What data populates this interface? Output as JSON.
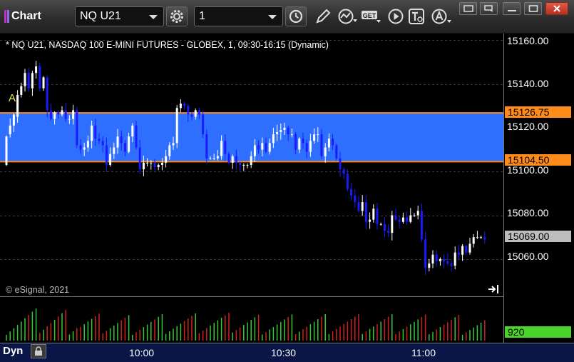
{
  "window": {
    "title": "Chart"
  },
  "toolbar": {
    "symbol": "NQ U21",
    "interval": "1",
    "icons": [
      "settings-gear-icon",
      "clock-icon",
      "pencil-icon",
      "study-icon",
      "get-icon",
      "play-icon",
      "text-tool-icon",
      "alert-icon"
    ],
    "get_label": "GET"
  },
  "chart": {
    "header": "* NQ U21, NASDAQ 100 E-MINI FUTURES - GLOBEX, 1, 09:30-16:15 (Dynamic)",
    "copyright": "© eSignal, 2021",
    "annotation": "A",
    "price_ticks": [
      "15160.00",
      "15140.00",
      "15120.00",
      "15100.00",
      "15080.00",
      "15060.00"
    ],
    "time_ticks": [
      "10:00",
      "10:30",
      "11:00"
    ],
    "zone_top": "15126.75",
    "zone_bottom": "15104.50",
    "last_price": "15069.00",
    "volume_last": "920",
    "mode": "Dyn"
  },
  "colors": {
    "zone": "#2f6fff",
    "zone_border": "#ff8c1a",
    "down": "#1a1aff",
    "up": "#ffffff",
    "vol_up": "#37c837",
    "vol_down": "#d02020"
  },
  "chart_data": {
    "type": "candlestick",
    "ylim": [
      15043,
      15163
    ],
    "zone": [
      15104.5,
      15126.75
    ],
    "opens": [
      15103,
      15117,
      15121,
      15125,
      15135,
      15139,
      15145,
      15138,
      15145,
      15148,
      15138,
      15143,
      15128,
      15124,
      15127,
      15126,
      15128,
      15124,
      15124,
      15128,
      15112,
      15110,
      15111,
      15114,
      15121,
      15115,
      15114,
      15112,
      15103,
      15108,
      15111,
      15116,
      15113,
      15109,
      15116,
      15121,
      15111,
      15101,
      15104,
      15104,
      15104,
      15102,
      15103,
      15104,
      15107,
      15112,
      15113,
      15129,
      15131,
      15130,
      15126,
      15125,
      15128,
      15126,
      15117,
      15106,
      15106,
      15106,
      15107,
      15114,
      15108,
      15104,
      15107,
      15104,
      15103,
      15103,
      15103,
      15107,
      15112,
      15110,
      15113,
      15109,
      15113,
      15117,
      15118,
      15119,
      15120,
      15117,
      15117,
      15110,
      15115,
      15113,
      15109,
      15114,
      15117,
      15117,
      15107,
      15111,
      15115,
      15112,
      15106,
      15101,
      15099,
      15092,
      15089,
      15086,
      15082,
      15086,
      15077,
      15078,
      15083,
      15076,
      15076,
      15073,
      15072,
      15080,
      15078,
      15077,
      15079,
      15077,
      15080,
      15080,
      15082,
      15069,
      15056,
      15058,
      15062,
      15059,
      15060,
      15059,
      15058,
      15057,
      15063,
      15062,
      15066,
      15063,
      15067,
      15070,
      15070,
      15070
    ],
    "closes": [
      15116,
      15121,
      15126,
      15135,
      15139,
      15145,
      15138,
      15145,
      15148,
      15138,
      15143,
      15128,
      15124,
      15127,
      15126,
      15128,
      15124,
      15124,
      15128,
      15112,
      15110,
      15111,
      15114,
      15121,
      15115,
      15114,
      15112,
      15103,
      15108,
      15111,
      15116,
      15113,
      15109,
      15116,
      15121,
      15111,
      15101,
      15104,
      15104,
      15104,
      15102,
      15103,
      15104,
      15107,
      15112,
      15113,
      15129,
      15131,
      15130,
      15126,
      15125,
      15128,
      15126,
      15117,
      15106,
      15106,
      15106,
      15107,
      15114,
      15108,
      15104,
      15107,
      15104,
      15103,
      15103,
      15103,
      15107,
      15112,
      15110,
      15113,
      15109,
      15113,
      15117,
      15118,
      15119,
      15120,
      15117,
      15117,
      15110,
      15115,
      15113,
      15109,
      15114,
      15117,
      15117,
      15107,
      15111,
      15115,
      15112,
      15106,
      15101,
      15099,
      15092,
      15089,
      15086,
      15082,
      15086,
      15077,
      15078,
      15083,
      15076,
      15076,
      15073,
      15072,
      15080,
      15078,
      15077,
      15079,
      15077,
      15080,
      15080,
      15082,
      15069,
      15056,
      15058,
      15062,
      15059,
      15060,
      15059,
      15058,
      15057,
      15063,
      15062,
      15066,
      15063,
      15067,
      15070,
      15070,
      15070,
      15069
    ],
    "volume_last": 920
  }
}
